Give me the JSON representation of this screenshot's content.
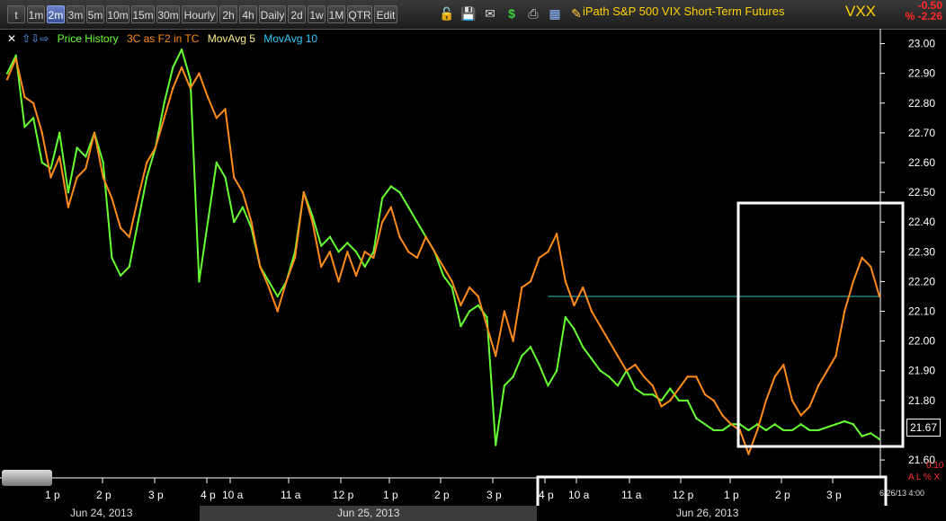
{
  "toolbar": {
    "intervals": [
      "t",
      "1m",
      "2m",
      "3m",
      "5m",
      "10m",
      "15m",
      "30m",
      "Hourly",
      "2h",
      "4h",
      "Daily",
      "2d",
      "1w",
      "1M",
      "QTR",
      "Edit"
    ],
    "active_interval": "2m",
    "title": "iPath S&P 500 VIX Short-Term Futures",
    "symbol": "VXX",
    "change": "-0.50",
    "change_pct": "% -2.26"
  },
  "legend": {
    "items": [
      {
        "label": "Price History",
        "color": "#66ff33"
      },
      {
        "label": "3C as F2 in TC",
        "color": "#ff8c1a"
      },
      {
        "label": "MovAvg 5",
        "color": "#ffee88"
      },
      {
        "label": "MovAvg 10",
        "color": "#33ccff"
      }
    ]
  },
  "right_panel": {
    "last_price": "21.67",
    "pct_small": "0.10",
    "alx": "A L % X",
    "datetime": "6/26/13 4:00"
  },
  "colors": {
    "price": "#66ff33",
    "indicator": "#ff8c1a",
    "hline": "#2cc4c4",
    "axis": "#ffffff",
    "box": "#ffffff"
  },
  "chart_data": {
    "type": "line",
    "title": "iPath S&P 500 VIX Short-Term Futures",
    "ylim": [
      21.57,
      23.05
    ],
    "y_ticks": [
      "23.00",
      "22.90",
      "22.80",
      "22.70",
      "22.60",
      "22.50",
      "22.40",
      "22.30",
      "22.20",
      "22.10",
      "22.00",
      "21.90",
      "21.80",
      "21.70",
      "21.60"
    ],
    "x_tick_labels": [
      "1 p",
      "2 p",
      "3 p",
      "4 p",
      "10 a",
      "11 a",
      "12 p",
      "1 p",
      "2 p",
      "3 p",
      "4 p",
      "10 a",
      "11 a",
      "12 p",
      "1 p",
      "2 p",
      "3 p"
    ],
    "date_labels": [
      "Jun 24, 2013",
      "Jun 25, 2013",
      "Jun 26, 2013"
    ],
    "x_range": [
      0,
      100
    ],
    "reference_line": 22.15,
    "series": [
      {
        "name": "Price History",
        "x": [
          0,
          1,
          2,
          3,
          4,
          5,
          6,
          7,
          8,
          9,
          10,
          11,
          12,
          13,
          14,
          15,
          16,
          17,
          18,
          19,
          20,
          21,
          22,
          23,
          24,
          25,
          26,
          27,
          28,
          29,
          30,
          31,
          32,
          33,
          34,
          35,
          36,
          37,
          38,
          39,
          40,
          41,
          42,
          43,
          44,
          45,
          46,
          47,
          48,
          49,
          50,
          51,
          52,
          53,
          54,
          55,
          56,
          57,
          58,
          59,
          60,
          61,
          62,
          63,
          64,
          65,
          66,
          67,
          68,
          69,
          70,
          71,
          72,
          73,
          74,
          75,
          76,
          77,
          78,
          79,
          80,
          81,
          82,
          83,
          84,
          85,
          86,
          87,
          88,
          89,
          90,
          91,
          92,
          93,
          94,
          95,
          96,
          97,
          98,
          99,
          100
        ],
        "values": [
          22.9,
          22.96,
          22.72,
          22.75,
          22.6,
          22.58,
          22.7,
          22.5,
          22.65,
          22.62,
          22.7,
          22.6,
          22.28,
          22.22,
          22.25,
          22.4,
          22.55,
          22.65,
          22.8,
          22.92,
          22.98,
          22.88,
          22.2,
          22.4,
          22.6,
          22.55,
          22.4,
          22.45,
          22.38,
          22.25,
          22.2,
          22.15,
          22.2,
          22.3,
          22.5,
          22.42,
          22.32,
          22.35,
          22.3,
          22.33,
          22.3,
          22.25,
          22.3,
          22.48,
          22.52,
          22.5,
          22.45,
          22.4,
          22.35,
          22.3,
          22.22,
          22.18,
          22.05,
          22.1,
          22.12,
          22.08,
          21.65,
          21.85,
          21.88,
          21.95,
          21.98,
          21.92,
          21.85,
          21.9,
          22.08,
          22.04,
          21.98,
          21.94,
          21.9,
          21.88,
          21.85,
          21.9,
          21.84,
          21.82,
          21.82,
          21.8,
          21.84,
          21.8,
          21.8,
          21.74,
          21.72,
          21.7,
          21.7,
          21.72,
          21.72,
          21.7,
          21.72,
          21.7,
          21.72,
          21.7,
          21.7,
          21.72,
          21.7,
          21.7,
          21.71,
          21.72,
          21.73,
          21.72,
          21.68,
          21.69,
          21.67
        ]
      },
      {
        "name": "3C as F2 in TC",
        "x": [
          0,
          1,
          2,
          3,
          4,
          5,
          6,
          7,
          8,
          9,
          10,
          11,
          12,
          13,
          14,
          15,
          16,
          17,
          18,
          19,
          20,
          21,
          22,
          23,
          24,
          25,
          26,
          27,
          28,
          29,
          30,
          31,
          32,
          33,
          34,
          35,
          36,
          37,
          38,
          39,
          40,
          41,
          42,
          43,
          44,
          45,
          46,
          47,
          48,
          49,
          50,
          51,
          52,
          53,
          54,
          55,
          56,
          57,
          58,
          59,
          60,
          61,
          62,
          63,
          64,
          65,
          66,
          67,
          68,
          69,
          70,
          71,
          72,
          73,
          74,
          75,
          76,
          77,
          78,
          79,
          80,
          81,
          82,
          83,
          84,
          85,
          86,
          87,
          88,
          89,
          90,
          91,
          92,
          93,
          94,
          95,
          96,
          97,
          98,
          99,
          100
        ],
        "values": [
          22.88,
          22.95,
          22.82,
          22.8,
          22.7,
          22.55,
          22.62,
          22.45,
          22.55,
          22.58,
          22.7,
          22.55,
          22.48,
          22.38,
          22.35,
          22.48,
          22.6,
          22.65,
          22.75,
          22.85,
          22.92,
          22.85,
          22.9,
          22.82,
          22.75,
          22.78,
          22.55,
          22.5,
          22.4,
          22.25,
          22.18,
          22.1,
          22.2,
          22.28,
          22.5,
          22.4,
          22.25,
          22.3,
          22.2,
          22.3,
          22.22,
          22.3,
          22.28,
          22.4,
          22.45,
          22.35,
          22.3,
          22.28,
          22.35,
          22.3,
          22.25,
          22.2,
          22.12,
          22.18,
          22.15,
          22.05,
          21.95,
          22.1,
          22.0,
          22.18,
          22.2,
          22.28,
          22.3,
          22.36,
          22.2,
          22.12,
          22.18,
          22.1,
          22.05,
          22.0,
          21.95,
          21.9,
          21.92,
          21.88,
          21.85,
          21.78,
          21.8,
          21.84,
          21.88,
          21.88,
          21.82,
          21.8,
          21.75,
          21.72,
          21.7,
          21.62,
          21.7,
          21.8,
          21.88,
          21.92,
          21.8,
          21.75,
          21.78,
          21.85,
          21.9,
          21.95,
          22.1,
          22.2,
          22.28,
          22.25,
          22.15
        ]
      }
    ]
  }
}
